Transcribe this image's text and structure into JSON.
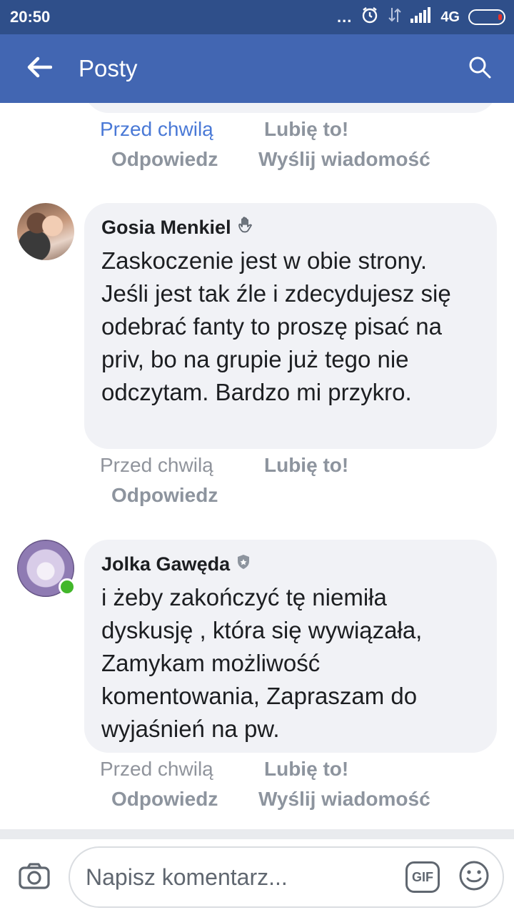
{
  "status_bar": {
    "time": "20:50",
    "dots": "...",
    "network": "4G"
  },
  "app_bar": {
    "title": "Posty",
    "back_icon": "arrow-left-icon",
    "search_icon": "search-icon"
  },
  "previous_comment_actions": {
    "time": "Przed chwilą",
    "like": "Lubię to!",
    "reply": "Odpowiedz",
    "message": "Wyślij wiadomość"
  },
  "comments": [
    {
      "author": "Gosia Menkiel",
      "badge_icon": "wave-hand-icon",
      "text": "Zaskoczenie jest w obie strony. Jeśli jest tak źle i zdecydujesz się odebrać fanty to proszę pisać na priv, bo na grupie już tego nie odczytam. Bardzo mi przykro.",
      "time": "Przed chwilą",
      "like": "Lubię to!",
      "reply": "Odpowiedz"
    },
    {
      "author": "Jolka Gawęda",
      "badge_icon": "admin-shield-icon",
      "online": true,
      "text": "i żeby zakończyć tę niemiła dyskusję , która się wywiązała, Zamykam możliwość komentowania, Zapraszam do wyjaśnień na pw.",
      "time": "Przed chwilą",
      "like": "Lubię to!",
      "reply": "Odpowiedz",
      "message": "Wyślij wiadomość"
    }
  ],
  "composer": {
    "placeholder": "Napisz komentarz...",
    "gif_label": "GIF",
    "camera_icon": "camera-icon",
    "emoji_icon": "emoji-icon"
  },
  "colors": {
    "status_bar": "#2f4f8a",
    "app_bar": "#4266b2",
    "bubble": "#f1f2f6",
    "link_blue": "#4a79d6",
    "muted": "#8d949e",
    "online": "#42b72a"
  }
}
